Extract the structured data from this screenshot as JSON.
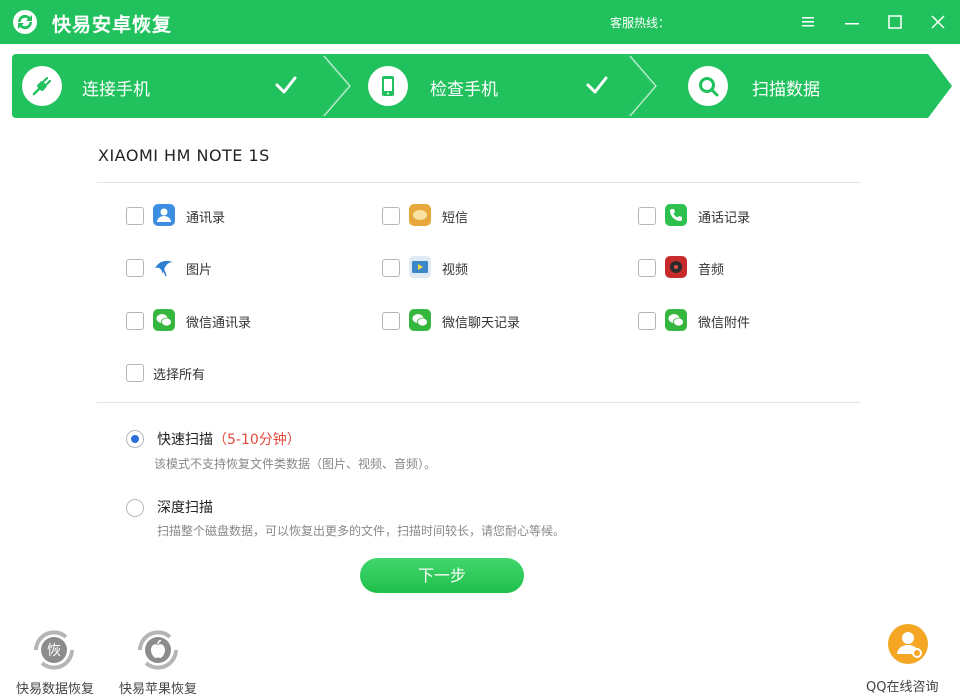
{
  "window": {
    "title": "快易安卓恢复",
    "hotline_label": "客服热线："
  },
  "steps": [
    {
      "label": "连接手机",
      "done": true
    },
    {
      "label": "检查手机",
      "done": true
    },
    {
      "label": "扫描数据",
      "done": false
    }
  ],
  "device": {
    "name": "XIAOMI HM NOTE 1S"
  },
  "categories": [
    {
      "label": "通讯录",
      "icon": "contacts-icon",
      "checked": false
    },
    {
      "label": "短信",
      "icon": "sms-icon",
      "checked": false
    },
    {
      "label": "通话记录",
      "icon": "call-log-icon",
      "checked": false
    },
    {
      "label": "图片",
      "icon": "photos-icon",
      "checked": false
    },
    {
      "label": "视频",
      "icon": "video-icon",
      "checked": false
    },
    {
      "label": "音频",
      "icon": "audio-icon",
      "checked": false
    },
    {
      "label": "微信通讯录",
      "icon": "wechat-contacts-icon",
      "checked": false
    },
    {
      "label": "微信聊天记录",
      "icon": "wechat-chat-icon",
      "checked": false
    },
    {
      "label": "微信附件",
      "icon": "wechat-attachment-icon",
      "checked": false
    }
  ],
  "select_all": {
    "label": "选择所有",
    "checked": false
  },
  "scan_modes": {
    "quick": {
      "title": "快速扫描",
      "time": "（5-10分钟）",
      "desc": "该模式不支持恢复文件类数据（图片、视频、音频）。",
      "selected": true
    },
    "deep": {
      "title": "深度扫描",
      "desc": "扫描整个磁盘数据，可以恢复出更多的文件，扫描时间较长，请您耐心等候。",
      "selected": false
    }
  },
  "next_button": {
    "label": "下一步"
  },
  "bottom": {
    "data_recovery": {
      "label": "快易数据恢复",
      "icon_text": "恢"
    },
    "apple_recovery": {
      "label": "快易苹果恢复"
    },
    "qq_consult": {
      "label": "QQ在线咨询"
    }
  },
  "colors": {
    "brand_green": "#21c25d",
    "radio_selected": "#2a6fd6",
    "time_red": "#e64a3c"
  }
}
